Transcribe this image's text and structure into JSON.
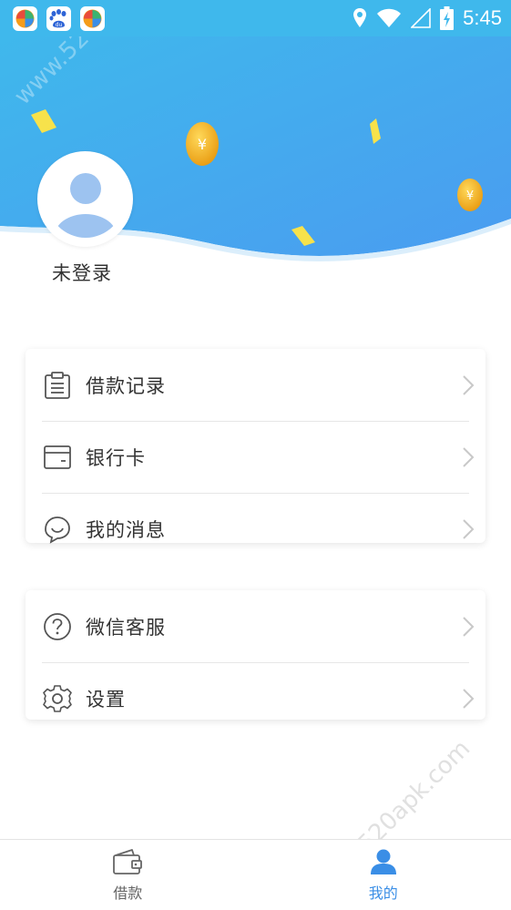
{
  "status_bar": {
    "time": "5:45",
    "apps": [
      "app-icon-1",
      "baidu-icon",
      "app-icon-3"
    ],
    "baidu_text": "du"
  },
  "profile": {
    "login_status": "未登录"
  },
  "menu_group_1": [
    {
      "label": "借款记录",
      "icon": "clipboard-icon"
    },
    {
      "label": "银行卡",
      "icon": "bank-card-icon"
    },
    {
      "label": "我的消息",
      "icon": "chat-bubbles-icon"
    }
  ],
  "menu_group_2": [
    {
      "label": "微信客服",
      "icon": "question-circle-icon"
    },
    {
      "label": "设置",
      "icon": "gear-icon"
    }
  ],
  "bottom_nav": {
    "items": [
      {
        "label": "借款",
        "icon": "wallet-icon",
        "active": false
      },
      {
        "label": "我的",
        "icon": "user-icon",
        "active": true
      }
    ]
  },
  "watermark": "www.520apk.com",
  "colors": {
    "header_top": "#3fb8ec",
    "header_bottom": "#4a9cf0",
    "accent": "#3a8ee6",
    "coin": "#f0b429"
  }
}
